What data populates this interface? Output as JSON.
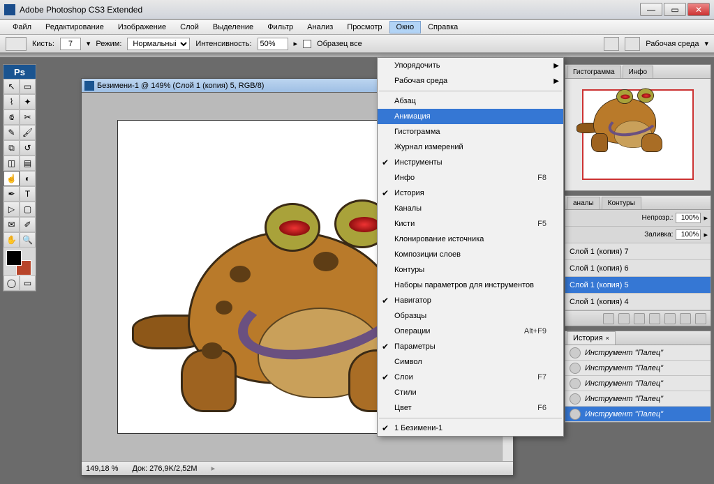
{
  "app": {
    "title": "Adobe Photoshop CS3 Extended"
  },
  "menubar": [
    "Файл",
    "Редактирование",
    "Изображение",
    "Слой",
    "Выделение",
    "Фильтр",
    "Анализ",
    "Просмотр",
    "Окно",
    "Справка"
  ],
  "menubar_open_index": 8,
  "optionbar": {
    "brush_label": "Кисть:",
    "brush_size": "7",
    "mode_label": "Режим:",
    "mode_value": "Нормальный",
    "intensity_label": "Интенсивность:",
    "intensity_value": "50%",
    "sample_label": "Образец все",
    "workspace_label": "Рабочая среда"
  },
  "dropdown": {
    "items": [
      {
        "label": "Упорядочить",
        "submenu": true
      },
      {
        "label": "Рабочая среда",
        "submenu": true
      },
      {
        "sep": true
      },
      {
        "label": "Абзац"
      },
      {
        "label": "Анимация",
        "highlight": true
      },
      {
        "label": "Гистограмма"
      },
      {
        "label": "Журнал измерений"
      },
      {
        "label": "Инструменты",
        "checked": true
      },
      {
        "label": "Инфо",
        "shortcut": "F8"
      },
      {
        "label": "История",
        "checked": true
      },
      {
        "label": "Каналы"
      },
      {
        "label": "Кисти",
        "shortcut": "F5"
      },
      {
        "label": "Клонирование источника"
      },
      {
        "label": "Композиции слоев"
      },
      {
        "label": "Контуры"
      },
      {
        "label": "Наборы параметров для инструментов"
      },
      {
        "label": "Навигатор",
        "checked": true
      },
      {
        "label": "Образцы"
      },
      {
        "label": "Операции",
        "shortcut": "Alt+F9"
      },
      {
        "label": "Параметры",
        "checked": true
      },
      {
        "label": "Символ"
      },
      {
        "label": "Слои",
        "checked": true,
        "shortcut": "F7"
      },
      {
        "label": "Стили"
      },
      {
        "label": "Цвет",
        "shortcut": "F6"
      },
      {
        "sep": true
      },
      {
        "label": "1 Безимени-1",
        "checked": true
      }
    ]
  },
  "document": {
    "title": "Безимени-1 @ 149% (Слой 1 (копия) 5, RGB/8)",
    "zoom": "149,18 %",
    "dim": "Док: 276,9K/2,52M"
  },
  "nav_panel": {
    "tabs": [
      "Гистограмма",
      "Инфо"
    ]
  },
  "channels_panel": {
    "tabs": [
      "аналы",
      "Контуры"
    ],
    "opacity_label": "Непрозр.:",
    "opacity_value": "100%",
    "fill_label": "Заливка:",
    "fill_value": "100%"
  },
  "layers": [
    {
      "name": "Слой 1 (копия) 7"
    },
    {
      "name": "Слой 1 (копия) 6"
    },
    {
      "name": "Слой 1 (копия) 5",
      "selected": true
    },
    {
      "name": "Слой 1 (копия) 4"
    }
  ],
  "history_panel": {
    "tab": "История"
  },
  "history": [
    {
      "name": "Инструмент \"Палец\""
    },
    {
      "name": "Инструмент \"Палец\""
    },
    {
      "name": "Инструмент \"Палец\""
    },
    {
      "name": "Инструмент \"Палец\""
    },
    {
      "name": "Инструмент \"Палец\"",
      "selected": true
    }
  ],
  "toolbox_logo": "Ps"
}
